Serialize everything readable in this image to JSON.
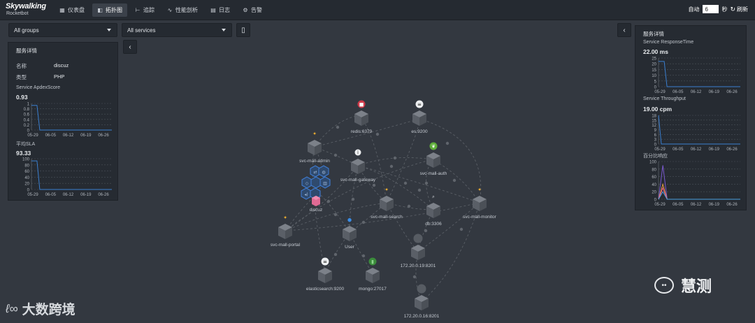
{
  "logo": {
    "main": "Skywalking",
    "sub": "Rocketbot"
  },
  "nav": [
    {
      "label": "仪表盘",
      "icon": "dashboard-icon",
      "active": false
    },
    {
      "label": "拓扑图",
      "icon": "topology-icon",
      "active": true
    },
    {
      "label": "追踪",
      "icon": "trace-icon",
      "active": false
    },
    {
      "label": "性能剖析",
      "icon": "profile-icon",
      "active": false
    },
    {
      "label": "日志",
      "icon": "log-icon",
      "active": false
    },
    {
      "label": "告警",
      "icon": "alarm-icon",
      "active": false
    }
  ],
  "auto_refresh": {
    "label": "自动",
    "value": "6",
    "unit": "秒",
    "refresh": "刷新"
  },
  "filters": {
    "groups": "All groups",
    "services": "All services"
  },
  "left_panel": {
    "title": "服务详情",
    "name_label": "名称",
    "name_value": "discuz",
    "type_label": "类型",
    "type_value": "PHP",
    "apdex_label": "Service ApdexScore",
    "apdex_value": "0.93",
    "sla_label": "平均SLA",
    "sla_value": "93.33"
  },
  "right_panel": {
    "title": "服务详情",
    "resp_label": "Service ResponseTime",
    "resp_value": "22.00 ms",
    "thr_label": "Service Throughput",
    "thr_value": "19.00 cpm",
    "pct_label": "百分比响应"
  },
  "charts": {
    "x_ticks": [
      "05-29",
      "06-05",
      "06-12",
      "06-19",
      "06-26"
    ],
    "apdex": {
      "yticks": [
        "1",
        "0.8",
        "0.6",
        "0.4",
        "0.2",
        "0"
      ]
    },
    "sla": {
      "yticks": [
        "100",
        "80",
        "60",
        "40",
        "20",
        "0"
      ]
    },
    "resp": {
      "yticks": [
        "25",
        "20",
        "15",
        "10",
        "5",
        "0"
      ]
    },
    "thr": {
      "yticks": [
        "18",
        "15",
        "12",
        "9",
        "6",
        "3",
        "0"
      ]
    },
    "pct": {
      "yticks": [
        "100",
        "80",
        "60",
        "40",
        "20",
        "0"
      ]
    }
  },
  "nodes": {
    "redis": "redis:6379",
    "es": "es:9200",
    "admin": "svc-mall-admin",
    "gateway": "svc-mall-gateway",
    "auth": "svc-mall-auth",
    "discuz": "discuz",
    "search": "svc-mall-search",
    "db": "db:3306",
    "monitor": "svc-mall-monitor",
    "portal": "svc-mall-portal",
    "user": "User",
    "ip19": "172.20.0.19:8201",
    "elastic": "elasticsearch:9200",
    "mongo": "mongo:27017",
    "ip16": "172.20.0.16:8201"
  },
  "watermarks": {
    "left": "大数跨境",
    "right": "慧测"
  },
  "colors": {
    "accent": "#4a8ee0",
    "line_series": "#3a7fd0",
    "pink": "#e85a8a",
    "yellow": "#f0b030"
  }
}
